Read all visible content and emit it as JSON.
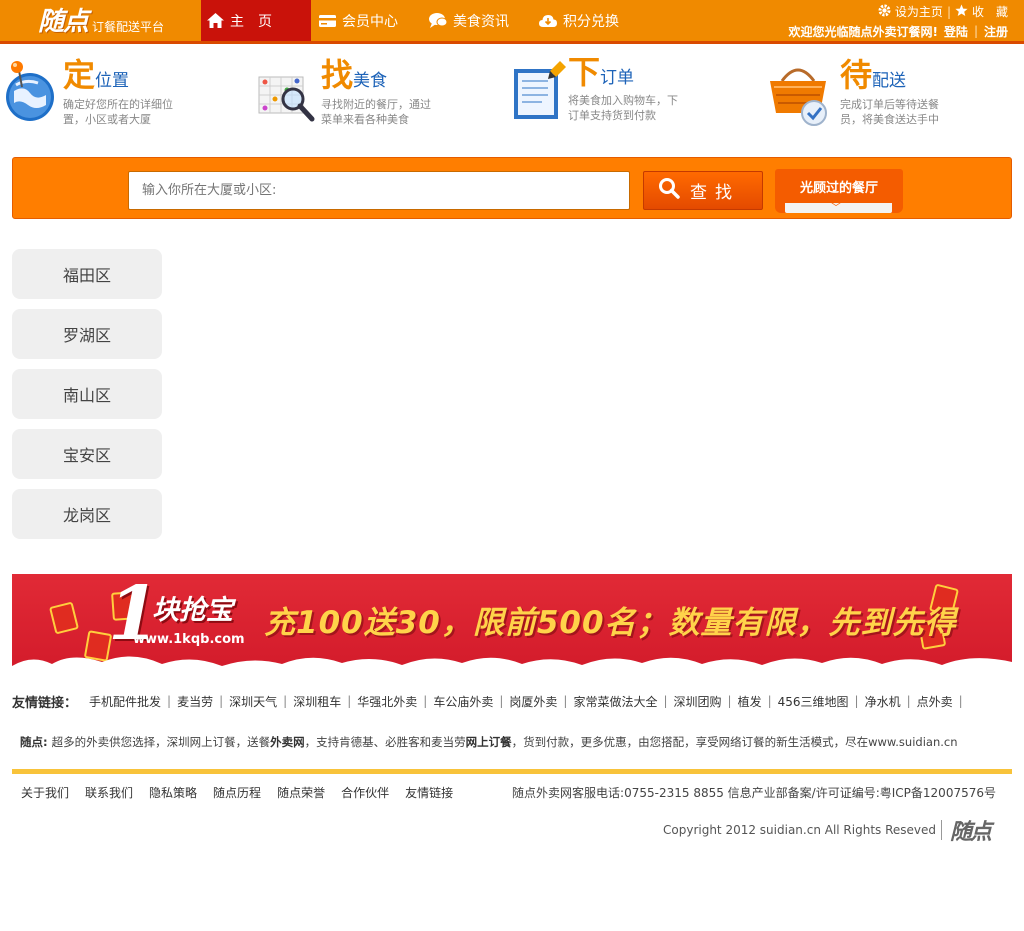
{
  "header": {
    "logo_text": "随点",
    "logo_sub": "订餐配送平台",
    "nav": [
      {
        "label": "主　页",
        "icon": "home-icon"
      },
      {
        "label": "会员中心",
        "icon": "card-icon"
      },
      {
        "label": "美食资讯",
        "icon": "chat-icon"
      },
      {
        "label": "积分兑换",
        "icon": "cloud-icon"
      }
    ],
    "set_home": "设为主页",
    "favorite": "收　藏",
    "welcome": "欢迎您光临随点外卖订餐网!",
    "login": "登陆",
    "register": "注册"
  },
  "steps": [
    {
      "big": "定",
      "small": "位置",
      "desc": "确定好您所在的详细位置，小区或者大厦",
      "icon": "globe-pin-icon"
    },
    {
      "big": "找",
      "small": "美食",
      "desc": "寻找附近的餐厅，通过菜单来看各种美食",
      "icon": "map-search-icon"
    },
    {
      "big": "下",
      "small": "订单",
      "desc": "将美食加入购物车，下订单支持货到付款",
      "icon": "order-form-icon"
    },
    {
      "big": "待",
      "small": "配送",
      "desc": "完成订单后等待送餐员，将美食送达手中",
      "icon": "basket-check-icon"
    }
  ],
  "search": {
    "placeholder": "输入你所在大厦或小区:",
    "button": "查找",
    "visited": "光顾过的餐厅"
  },
  "districts": [
    "福田区",
    "罗湖区",
    "南山区",
    "宝安区",
    "龙岗区"
  ],
  "banner": {
    "one": "1",
    "brand": "块抢宝",
    "url": "www.1kqb.com",
    "slogan": "充100送30，限前500名；数量有限，先到先得"
  },
  "friends": {
    "label": "友情链接：",
    "links": [
      "手机配件批发",
      "麦当劳",
      "深圳天气",
      "深圳租车",
      "华强北外卖",
      "车公庙外卖",
      "岗厦外卖",
      "家常菜做法大全",
      "深圳团购",
      "植发",
      "456三维地图",
      "净水机",
      "点外卖"
    ]
  },
  "slogan": {
    "lead": "随点:",
    "text1": "超多的外卖供您选择，深圳网上订餐，送餐",
    "bold1": "外卖网",
    "text2": "，支持肯德基、必胜客和麦当劳",
    "bold2": "网上订餐",
    "text3": "，货到付款，更多优惠，由您搭配，享受网络订餐的新生活模式，尽在www.suidian.cn"
  },
  "footer": {
    "links": [
      "关于我们",
      "联系我们",
      "隐私策略",
      "随点历程",
      "随点荣誉",
      "合作伙伴",
      "友情链接"
    ],
    "info": "随点外卖网客服电话:0755-2315 8855   信息产业部备案/许可证编号:粤ICP备12007576号",
    "copyright": "Copyright 2012 suidian.cn All Rights Reseved",
    "logo": "随点"
  },
  "colors": {
    "brand_orange": "#f08a00",
    "nav_active": "#c9120a",
    "search_band": "#ff7e00",
    "banner_red": "#d21a2a",
    "divider": "#f8c33a",
    "step_blue": "#1d63b8"
  }
}
